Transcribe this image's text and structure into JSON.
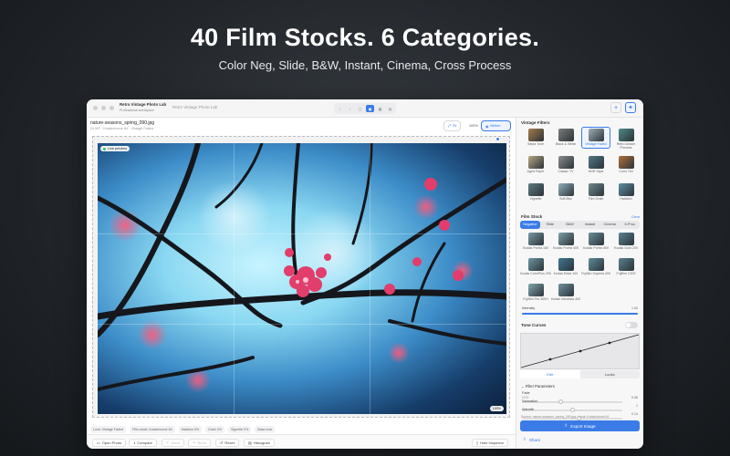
{
  "hero": {
    "title": "40 Film Stocks. 6 Categories.",
    "subtitle": "Color Neg, Slide, B&W, Instant, Cinema, Cross Process"
  },
  "window": {
    "app_name": "Retro Vintage Photo Lab",
    "app_subtitle": "Professional workspace",
    "title": "Retro Vintage Photo Lab"
  },
  "toolbar": {
    "view_modes": [
      "‹",
      "›",
      "▢",
      "▣",
      "▦",
      "▤"
    ],
    "active_view_index": 3,
    "right_icons": [
      "+",
      "✦"
    ]
  },
  "document": {
    "filename": "nature-seasons_spring_090.jpg",
    "meta": "24 MP · Kodachrome 64 · Vintage Faded",
    "fit_label": "Fit",
    "zoom_label": "100%",
    "before_label": "Before"
  },
  "canvas": {
    "live_label": "Live preview",
    "zoom_badge": "100%"
  },
  "chips": [
    "Look: Vintage Faded",
    "Film stock: Kodachrome 64",
    "Halation 0%",
    "Grain 0%",
    "Vignette 0%",
    "Base look"
  ],
  "bottom_bar": {
    "open_photo": "Open Photo",
    "compare": "Compare",
    "undo": "Undo",
    "redo": "Redo",
    "reset": "Reset",
    "histogram": "Histogram",
    "hide_inspector": "Hide Inspector"
  },
  "inspector": {
    "vintage_title": "Vintage Filters",
    "filters": [
      {
        "label": "Sepia Tone",
        "color": "#a77c4e"
      },
      {
        "label": "Black & White",
        "color": "#7d7d7d"
      },
      {
        "label": "Vintage Faded",
        "color": "#9fb0b7"
      },
      {
        "label": "Retro Dream Process",
        "color": "#4e8a86"
      },
      {
        "label": "Aged Paper",
        "color": "#b7a583"
      },
      {
        "label": "Classic TV",
        "color": "#8a8f8f"
      },
      {
        "label": "HDR Style",
        "color": "#4f7787"
      },
      {
        "label": "Color Tint",
        "color": "#b0703d"
      },
      {
        "label": "Vignette",
        "color": "#5d7a80"
      },
      {
        "label": "Soft Blur",
        "color": "#8fb1bd"
      },
      {
        "label": "Film Grain",
        "color": "#6f8a8d"
      },
      {
        "label": "Halation",
        "color": "#5f8ea3"
      }
    ],
    "film_title": "Film Stock",
    "clear_label": "Clear",
    "film_tabs": [
      "Negative",
      "Slide",
      "B&W",
      "Instant",
      "Cinema",
      "X-Proc"
    ],
    "film_stocks": [
      {
        "label": "Kodak Portra 160",
        "color": "#7a9aa4"
      },
      {
        "label": "Kodak Portra 400",
        "color": "#7ea0a8"
      },
      {
        "label": "Kodak Portra 800",
        "color": "#6c8f9b"
      },
      {
        "label": "Kodak Gold 200",
        "color": "#5d8394"
      },
      {
        "label": "Kodak ColorPlus 200",
        "color": "#6d97a2"
      },
      {
        "label": "Kodak Ektar 100",
        "color": "#3f7795"
      },
      {
        "label": "Fujifilm Superia 400",
        "color": "#5e8d9c"
      },
      {
        "label": "Fujifilm C200",
        "color": "#5a8290"
      },
      {
        "label": "Fujifilm Pro 400H",
        "color": "#86a6b0"
      },
      {
        "label": "Kodak UltraMax 400",
        "color": "#6f92a0"
      }
    ],
    "intensity_label": "Intensity",
    "intensity_value": "1.00",
    "intensity_level": 1.0,
    "tone_title": "Tone Curves",
    "curve_tabs": [
      "Edit",
      "Looks"
    ],
    "params_title": "Filter Parameters",
    "params": [
      {
        "label": "Fade",
        "sub": "HGS",
        "value": "0.38",
        "level": 0.38
      },
      {
        "label": "Saturation",
        "sub": "",
        "value": "1",
        "level": 0.5
      },
      {
        "label": "Warmth",
        "sub": "",
        "value": "0.14",
        "level": 0.57
      }
    ],
    "source_line": "Source: nature-seasons_spring_090.jpg  ·  Look: Kodachrome 64",
    "export_label": "Export Image",
    "share_label": "Share"
  }
}
